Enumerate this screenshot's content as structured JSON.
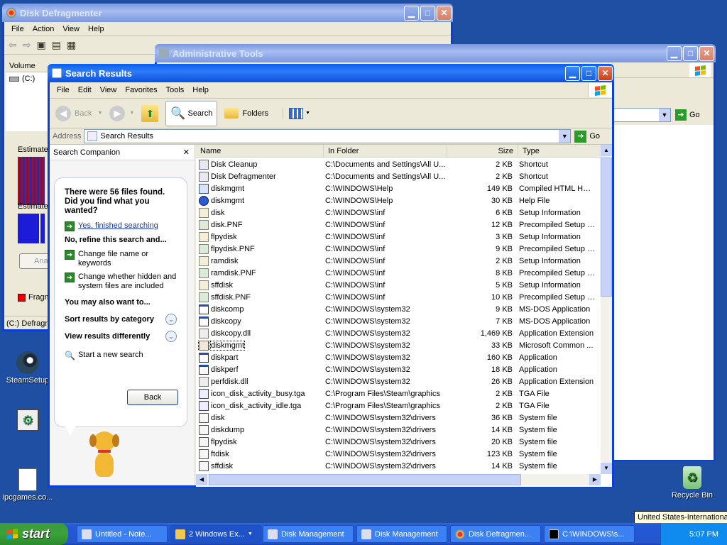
{
  "desktop": {
    "icons": [
      {
        "label": "SteamSetup"
      },
      {
        "label": ""
      },
      {
        "label": "ipcgames.co..."
      },
      {
        "label": "Recycle Bin"
      }
    ],
    "tooltip": "United States-International"
  },
  "defrag": {
    "title": "Disk Defragmenter",
    "menu": [
      "File",
      "Action",
      "View",
      "Help"
    ],
    "volume_header": "Volume",
    "volume": "(C:)",
    "estimated1": "Estimated",
    "estimated2": "Estimated",
    "analyze_btn": "Anal",
    "legend": "Fragm",
    "status": "(C:) Defragm"
  },
  "admin": {
    "title": "Administrative Tools",
    "go": "Go"
  },
  "search": {
    "title": "Search Results",
    "menu": [
      "File",
      "Edit",
      "View",
      "Favorites",
      "Tools",
      "Help"
    ],
    "toolbar": {
      "back": "Back",
      "search": "Search",
      "folders": "Folders"
    },
    "address_label": "Address",
    "address_value": "Search Results",
    "go": "Go",
    "companion": {
      "title": "Search Companion",
      "close": "✕",
      "found": "There were 56 files found. Did you find what you wanted?",
      "yes": "Yes, finished searching",
      "refine": "No, refine this search and...",
      "opt1": "Change file name or keywords",
      "opt2": "Change whether hidden and system files are included",
      "also": "You may also want to...",
      "sort": "Sort results by category",
      "view": "View results differently",
      "new_search": "Start a new search",
      "back_btn": "Back"
    },
    "columns": [
      "Name",
      "In Folder",
      "Size",
      "Type"
    ],
    "rows": [
      {
        "name": "Disk Cleanup",
        "folder": "C:\\Documents and Settings\\All U...",
        "size": "2 KB",
        "type": "Shortcut",
        "icon": "shortcut-icon"
      },
      {
        "name": "Disk Defragmenter",
        "folder": "C:\\Documents and Settings\\All U...",
        "size": "2 KB",
        "type": "Shortcut",
        "icon": "shortcut-icon"
      },
      {
        "name": "diskmgmt",
        "folder": "C:\\WINDOWS\\Help",
        "size": "149 KB",
        "type": "Compiled HTML Help...",
        "icon": "chm-icon"
      },
      {
        "name": "diskmgmt",
        "folder": "C:\\WINDOWS\\Help",
        "size": "30 KB",
        "type": "Help File",
        "icon": "help-icon"
      },
      {
        "name": "disk",
        "folder": "C:\\WINDOWS\\inf",
        "size": "6 KB",
        "type": "Setup Information",
        "icon": "inf-icon"
      },
      {
        "name": "disk.PNF",
        "folder": "C:\\WINDOWS\\inf",
        "size": "12 KB",
        "type": "Precompiled Setup I...",
        "icon": "pnf-icon"
      },
      {
        "name": "flpydisk",
        "folder": "C:\\WINDOWS\\inf",
        "size": "3 KB",
        "type": "Setup Information",
        "icon": "inf-icon"
      },
      {
        "name": "flpydisk.PNF",
        "folder": "C:\\WINDOWS\\inf",
        "size": "9 KB",
        "type": "Precompiled Setup I...",
        "icon": "pnf-icon"
      },
      {
        "name": "ramdisk",
        "folder": "C:\\WINDOWS\\inf",
        "size": "2 KB",
        "type": "Setup Information",
        "icon": "inf-icon"
      },
      {
        "name": "ramdisk.PNF",
        "folder": "C:\\WINDOWS\\inf",
        "size": "8 KB",
        "type": "Precompiled Setup I...",
        "icon": "pnf-icon"
      },
      {
        "name": "sffdisk",
        "folder": "C:\\WINDOWS\\inf",
        "size": "5 KB",
        "type": "Setup Information",
        "icon": "inf-icon"
      },
      {
        "name": "sffdisk.PNF",
        "folder": "C:\\WINDOWS\\inf",
        "size": "10 KB",
        "type": "Precompiled Setup I...",
        "icon": "pnf-icon"
      },
      {
        "name": "diskcomp",
        "folder": "C:\\WINDOWS\\system32",
        "size": "9 KB",
        "type": "MS-DOS Application",
        "icon": "dos-icon"
      },
      {
        "name": "diskcopy",
        "folder": "C:\\WINDOWS\\system32",
        "size": "7 KB",
        "type": "MS-DOS Application",
        "icon": "dos-icon"
      },
      {
        "name": "diskcopy.dll",
        "folder": "C:\\WINDOWS\\system32",
        "size": "1,469 KB",
        "type": "Application Extension",
        "icon": "dll-icon"
      },
      {
        "name": "diskmgmt",
        "folder": "C:\\WINDOWS\\system32",
        "size": "33 KB",
        "type": "Microsoft Common ...",
        "icon": "msc-icon"
      },
      {
        "name": "diskpart",
        "folder": "C:\\WINDOWS\\system32",
        "size": "160 KB",
        "type": "Application",
        "icon": "app-icon"
      },
      {
        "name": "diskperf",
        "folder": "C:\\WINDOWS\\system32",
        "size": "18 KB",
        "type": "Application",
        "icon": "app-icon"
      },
      {
        "name": "perfdisk.dll",
        "folder": "C:\\WINDOWS\\system32",
        "size": "26 KB",
        "type": "Application Extension",
        "icon": "dll-icon"
      },
      {
        "name": "icon_disk_activity_busy.tga",
        "folder": "C:\\Program Files\\Steam\\graphics",
        "size": "2 KB",
        "type": "TGA File",
        "icon": "tga-icon"
      },
      {
        "name": "icon_disk_activity_idle.tga",
        "folder": "C:\\Program Files\\Steam\\graphics",
        "size": "2 KB",
        "type": "TGA File",
        "icon": "tga-icon"
      },
      {
        "name": "disk",
        "folder": "C:\\WINDOWS\\system32\\drivers",
        "size": "36 KB",
        "type": "System file",
        "icon": "sys-icon"
      },
      {
        "name": "diskdump",
        "folder": "C:\\WINDOWS\\system32\\drivers",
        "size": "14 KB",
        "type": "System file",
        "icon": "sys-icon"
      },
      {
        "name": "flpydisk",
        "folder": "C:\\WINDOWS\\system32\\drivers",
        "size": "20 KB",
        "type": "System file",
        "icon": "sys-icon"
      },
      {
        "name": "ftdisk",
        "folder": "C:\\WINDOWS\\system32\\drivers",
        "size": "123 KB",
        "type": "System file",
        "icon": "sys-icon"
      },
      {
        "name": "sffdisk",
        "folder": "C:\\WINDOWS\\system32\\drivers",
        "size": "14 KB",
        "type": "System file",
        "icon": "sys-icon"
      }
    ]
  },
  "taskbar": {
    "start": "start",
    "tasks": [
      {
        "label": "Untitled - Note..."
      },
      {
        "label": "2 Windows Ex..."
      },
      {
        "label": "Disk Management"
      },
      {
        "label": "Disk Management"
      },
      {
        "label": "Disk Defragmen..."
      },
      {
        "label": "C:\\WINDOWS\\s..."
      }
    ],
    "time": "5:07 PM"
  }
}
